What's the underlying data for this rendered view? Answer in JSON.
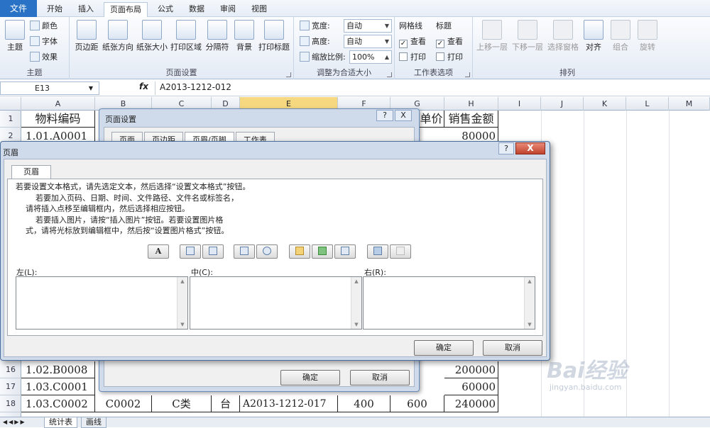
{
  "ribbon_tabs": [
    "文件",
    "开始",
    "插入",
    "页面布局",
    "公式",
    "数据",
    "审阅",
    "视图"
  ],
  "active_tab": "页面布局",
  "ribbon": {
    "theme": {
      "big": "主题",
      "colors": "颜色",
      "fonts": "字体",
      "effects": "效果",
      "group": "主题"
    },
    "page_setup": {
      "margins": "页边距",
      "orientation": "纸张方向",
      "size": "纸张大小",
      "print_area": "打印区域",
      "breaks": "分隔符",
      "background": "背景",
      "print_titles": "打印标题",
      "group": "页面设置"
    },
    "scale": {
      "width_label": "宽度:",
      "width_value": "自动",
      "height_label": "高度:",
      "height_value": "自动",
      "scale_label": "缩放比例:",
      "scale_value": "100%",
      "group": "调整为合适大小"
    },
    "sheet_options": {
      "gridlines": "网格线",
      "headings": "标题",
      "view": "查看",
      "print": "打印",
      "group": "工作表选项"
    },
    "arrange": {
      "forward": "上移一层",
      "backward": "下移一层",
      "pane": "选择窗格",
      "align": "对齐",
      "group_btn": "组合",
      "rotate": "旋转",
      "group": "排列"
    }
  },
  "formula_bar": {
    "cell_ref": "E13",
    "fx": "fx",
    "value": "A2013-1212-012"
  },
  "columns": [
    "A",
    "B",
    "C",
    "D",
    "E",
    "F",
    "G",
    "H",
    "I",
    "J",
    "K",
    "L",
    "M"
  ],
  "selected_column": "E",
  "rows": [
    "1",
    "2",
    "16",
    "17",
    "18"
  ],
  "cells": {
    "r1": {
      "a": "物料编码",
      "g": "单价",
      "h": "销售金额"
    },
    "r2": {
      "a": "1.01.A0001",
      "h": "80000"
    },
    "r16": {
      "a": "1.02.B0008",
      "h": "200000"
    },
    "r17": {
      "a": "1.03.C0001",
      "h": "60000"
    },
    "r18": {
      "a": "1.03.C0002",
      "b": "C0002",
      "c": "C类",
      "d": "台",
      "e": "A2013-1212-017",
      "f": "400",
      "g": "600",
      "h": "240000"
    }
  },
  "sheet_tabs": [
    "统计表",
    "画线"
  ],
  "page_setup_dialog": {
    "title": "页面设置",
    "tabs": [
      "页面",
      "页边距",
      "页眉/页脚",
      "工作表"
    ],
    "ok": "确定",
    "cancel": "取消",
    "help": "?",
    "close": "X"
  },
  "header_dialog": {
    "title": "页眉",
    "tab": "页眉",
    "help": "?",
    "close": "X",
    "instructions": "若要设置文本格式，请先选定文本，然后选择“设置文本格式”按钮。\n        若要加入页码、日期、时间、文件路径、文件名或标签名，\n    请将插入点移至编辑框内，然后选择相应按钮。\n        若要插入图片，请按“插入图片”按钮。若要设置图片格\n    式，请将光标放到编辑框中，然后按“设置图片格式”按钮。",
    "toolbar_font": "A",
    "left_label": "左(L):",
    "center_label": "中(C):",
    "right_label": "右(R):",
    "ok": "确定",
    "cancel": "取消"
  },
  "watermark": {
    "brand": "Bai经验",
    "site": "jingyan.baidu.com"
  }
}
